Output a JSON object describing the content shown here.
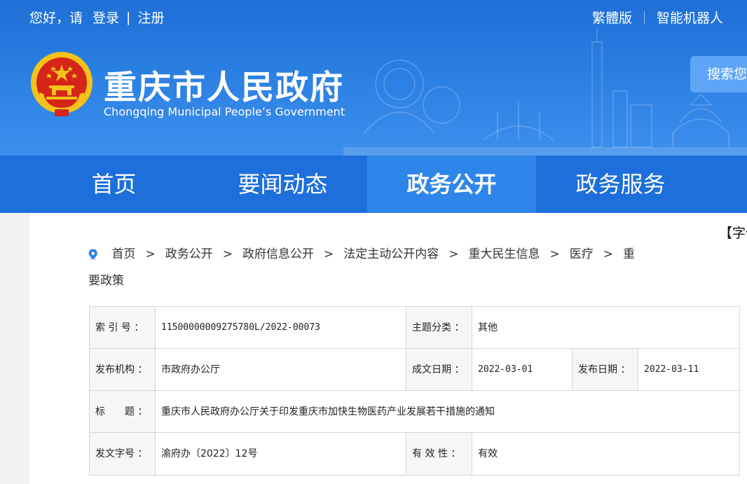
{
  "top_bar": {
    "greeting": "您好，请",
    "login": "登录",
    "separator": "|",
    "register": "注册",
    "traditional": "繁體版",
    "robot": "智能机器人"
  },
  "site": {
    "title_cn": "重庆市人民政府",
    "title_en": "Chongqing Municipal People’s Government"
  },
  "search": {
    "label": "搜索您"
  },
  "nav": {
    "items": [
      {
        "label": "首页"
      },
      {
        "label": "要闻动态"
      },
      {
        "label": "政务公开"
      },
      {
        "label": "政务服务"
      }
    ],
    "active_index": 2
  },
  "font_ctrl": "【字体",
  "breadcrumb": {
    "items": [
      "首页",
      "政务公开",
      "政府信息公开",
      "法定主动公开内容",
      "重大民生信息",
      "医疗",
      "重"
    ],
    "continuation": "要政策",
    "separator": ">"
  },
  "info": {
    "index_label": "索 引 号 ：",
    "index_value": "11500000009275780L/2022-00073",
    "topic_label": "主题分类 ：",
    "topic_value": "其他",
    "org_label": "发布机构 ：",
    "org_value": "市政府办公厅",
    "created_label": "成文日期 ：",
    "created_value": "2022-03-01",
    "published_label": "发布日期 ：",
    "published_value": "2022-03-11",
    "title_label": "标　　题 ：",
    "title_value": "重庆市人民政府办公厅关于印发重庆市加快生物医药产业发展若干措施的通知",
    "docno_label": "发文字号 ：",
    "docno_value": "渝府办〔2022〕12号",
    "validity_label": "有 效 性 ：",
    "validity_value": "有效"
  },
  "colors": {
    "header_blue": "#2a7fe2",
    "nav_blue": "#1d6fdb",
    "nav_active": "#2f86ea",
    "emblem_red": "#d62418",
    "emblem_gold": "#f5c21b"
  }
}
